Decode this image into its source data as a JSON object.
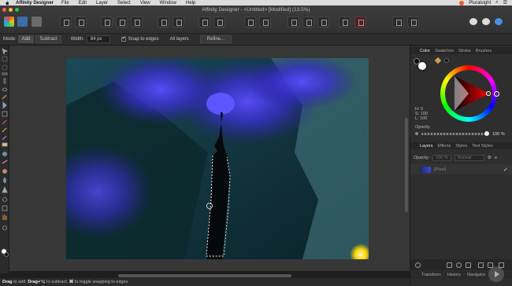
{
  "menubar": {
    "app_name": "Affinity Designer",
    "items": [
      "File",
      "Edit",
      "Layer",
      "Select",
      "View",
      "Window",
      "Help"
    ],
    "right_label": "Pluralsight"
  },
  "window": {
    "title": "Affinity Designer - <Untitled> [Modified] (13.5%)"
  },
  "context_toolbar": {
    "mode_label": "Mode:",
    "mode_add": "Add",
    "mode_subtract": "Subtract",
    "width_label": "Width:",
    "width_value": "84 px",
    "snap_label": "Snap to edges",
    "all_layers_label": "All layers",
    "refine_label": "Refine..."
  },
  "status_bar": {
    "drag_label": "Drag",
    "drag_text": "to add.",
    "drag2_label": "Drag+⌥",
    "drag2_text": "to subtract.",
    "key_label": "⌘",
    "key_text": "to toggle snapping to edges"
  },
  "color_panel": {
    "tabs": [
      "Color",
      "Swatches",
      "Stroke",
      "Brushes"
    ],
    "h": "H: 0",
    "s": "S: 100",
    "l": "L: 100",
    "opacity_label": "Opacity",
    "opacity_value": "100 %"
  },
  "layers_panel": {
    "tabs": [
      "Layers",
      "Effects",
      "Styles",
      "Text Styles"
    ],
    "opacity_label": "Opacity:",
    "opacity_value": "100 %",
    "blend_mode": "Normal",
    "layer_name": "(Pixel)"
  },
  "bottom_tabs": [
    "Transform",
    "History",
    "Navigator"
  ],
  "colors": {
    "accent_red": "#cc1a1a",
    "smoke_blue": "#3b33e0"
  }
}
